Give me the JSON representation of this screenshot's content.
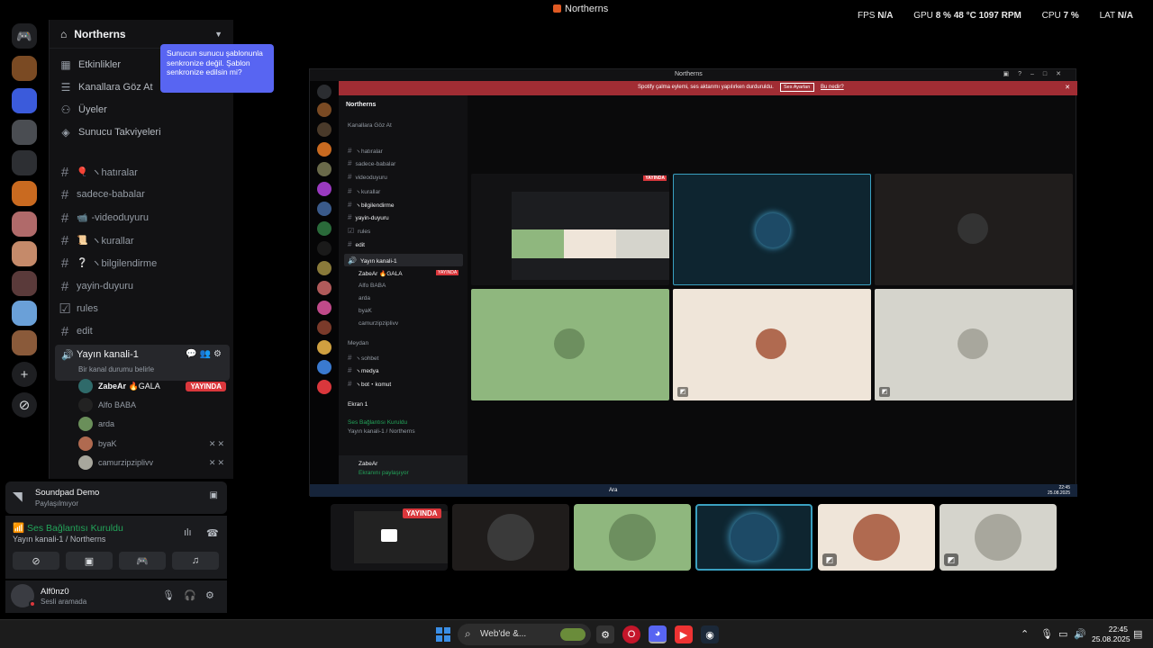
{
  "app": {
    "title": "Northerns"
  },
  "hud": {
    "fps_label": "FPS",
    "fps_value": "N/A",
    "gpu_label": "GPU",
    "gpu_value": "8 %",
    "gpu_temp": "48 °C",
    "gpu_rpm": "1097 RPM",
    "cpu_label": "CPU",
    "cpu_value": "7 %",
    "lat_label": "LAT",
    "lat_value": "N/A"
  },
  "server": {
    "name": "Northerns",
    "nav": [
      {
        "icon": "calendar-icon",
        "label": "Etkinlikler"
      },
      {
        "icon": "channels-icon",
        "label": "Kanallara Göz At"
      },
      {
        "icon": "members-icon",
        "label": "Üyeler"
      },
      {
        "icon": "boost-icon",
        "label": "Sunucu Takviyeleri"
      }
    ],
    "channels": [
      {
        "emoji": "🎈",
        "label": "ヽhatıralar"
      },
      {
        "emoji": "",
        "label": "sadece-babalar"
      },
      {
        "emoji": "📹",
        "label": "-videoduyuru"
      },
      {
        "emoji": "📜",
        "label": "ヽkurallar"
      },
      {
        "emoji": "❔",
        "label": "ヽbilgilendirme"
      },
      {
        "emoji": "",
        "label": "yayin-duyuru"
      },
      {
        "emoji": "",
        "label": "rules"
      },
      {
        "emoji": "",
        "label": "edit"
      }
    ],
    "voice_channel": {
      "name": "Yayın kanali-1",
      "status_placeholder": "Bir kanal durumu belirle",
      "users": [
        {
          "name": "ZabeAr",
          "tag": "🔥GALA",
          "live": "YAYINDA"
        },
        {
          "name": "Alfo BABA"
        },
        {
          "name": "arda"
        },
        {
          "name": "byaK"
        },
        {
          "name": "camurzipziplivv"
        }
      ]
    }
  },
  "tooltip": {
    "text": "Sunucun sunucu şablonunla senkronize değil. Şablon senkronize edilsin mi?"
  },
  "soundpad": {
    "title": "Soundpad Demo",
    "subtitle": "Paylaşılmıyor"
  },
  "voice_connection": {
    "status": "Ses Bağlantısı Kuruldu",
    "location": "Yayın kanali-1 / Northerns"
  },
  "user": {
    "name": "Alf0nz0",
    "status": "Sesli aramada"
  },
  "shared_window": {
    "title": "Northerns",
    "banner_text": "Spotify çalma eylemi, ses aktarımı yapılırken durduruldu.",
    "banner_button": "Ses Ayarları",
    "banner_link": "Bu nedir?",
    "server_name": "Northerns",
    "browse": "Kanallara Göz At",
    "channels": [
      "ヽhatıralar",
      "sadece-babalar",
      "videoduyuru",
      "ヽkurallar",
      "ヽbilgilendirme",
      "yayin-duyuru",
      "rules",
      "edit",
      "Yayın kanali-1"
    ],
    "users": [
      "ZabeAr 🔥GALA",
      "Alfo BABA",
      "arda",
      "byaK",
      "camurzipziplivv"
    ],
    "live": "YAYINDA",
    "more": [
      "Meydan",
      "ヽsohbet",
      "ヽmedya",
      "ヽbot・komut"
    ],
    "extra_user": "Ekran 1",
    "conn_status": "Ses Bağlantısı Kuruldu",
    "conn_where": "Yayın kanali-1 / Northerns",
    "me": "ZabeAr",
    "me_status": "Ekranını paylaşıyor",
    "task_search": "Ara",
    "task_time": "22:45",
    "task_date": "25.08.2025"
  },
  "strip": {
    "live": "YAYINDA"
  },
  "taskbar": {
    "search": "Web'de &...",
    "time": "22:45",
    "date": "25.08.2025"
  },
  "colors": {
    "blurple": "#5865f2",
    "live_red": "#da373c",
    "green": "#23a55a",
    "tile_green": "#8fb77e",
    "tile_cream": "#efe5d9",
    "tile_grey": "#d5d4cc"
  }
}
